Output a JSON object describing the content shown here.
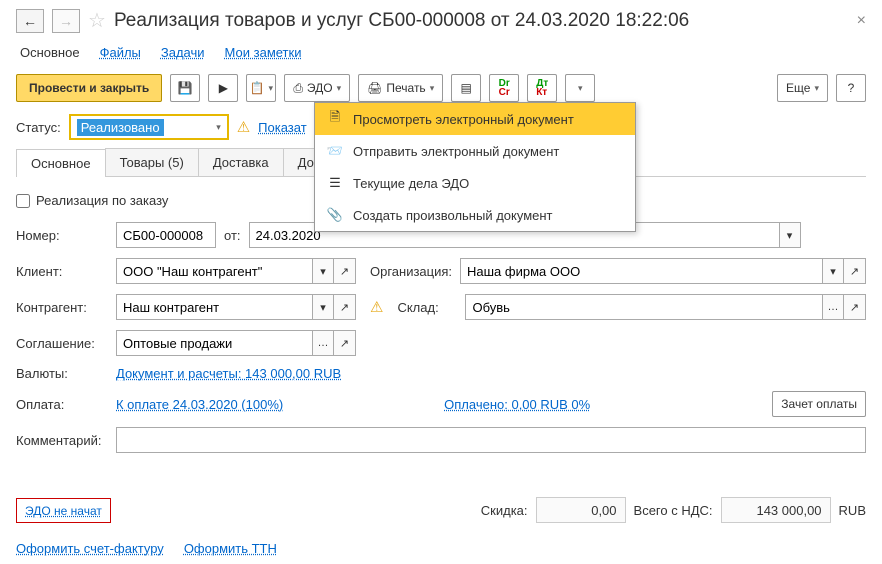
{
  "header": {
    "title": "Реализация товаров и услуг СБ00-000008 от 24.03.2020 18:22:06"
  },
  "navtabs": {
    "main": "Основное",
    "files": "Файлы",
    "tasks": "Задачи",
    "notes": "Мои заметки"
  },
  "toolbar": {
    "post_close": "Провести и закрыть",
    "edo": "ЭДО",
    "print": "Печать",
    "more": "Еще"
  },
  "edo_menu": {
    "view": "Просмотреть электронный документ",
    "send": "Отправить электронный документ",
    "current": "Текущие дела ЭДО",
    "create": "Создать произвольный документ"
  },
  "status": {
    "label": "Статус:",
    "value": "Реализовано",
    "show_link": "Показат"
  },
  "tabs": {
    "main": "Основное",
    "goods": "Товары (5)",
    "delivery": "Доставка",
    "extra": "Дополни"
  },
  "form": {
    "by_order": "Реализация по заказу",
    "number_lbl": "Номер:",
    "number": "СБ00-000008",
    "date_lbl": "от:",
    "date": "24.03.2020",
    "client_lbl": "Клиент:",
    "client": "ООО \"Наш контрагент\"",
    "org_lbl": "Организация:",
    "org": "Наша фирма ООО",
    "contragent_lbl": "Контрагент:",
    "contragent": "Наш контрагент",
    "warehouse_lbl": "Склад:",
    "warehouse": "Обувь",
    "agreement_lbl": "Соглашение:",
    "agreement": "Оптовые продажи",
    "currency_lbl": "Валюты:",
    "currency_link": "Документ и расчеты: 143 000,00 RUB",
    "payment_lbl": "Оплата:",
    "payment_link": "К оплате 24.03.2020 (100%)",
    "paid_link": "Оплачено: 0,00 RUB  0%",
    "offset_btn": "Зачет оплаты",
    "comment_lbl": "Комментарий:"
  },
  "footer": {
    "edo_status": "ЭДО не начат",
    "discount_lbl": "Скидка:",
    "discount": "0,00",
    "total_lbl": "Всего с НДС:",
    "total": "143 000,00",
    "currency": "RUB"
  },
  "bottom": {
    "invoice": "Оформить счет-фактуру",
    "ttn": "Оформить ТТН"
  }
}
